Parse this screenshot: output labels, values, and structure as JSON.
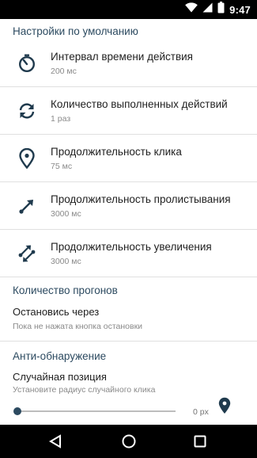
{
  "status_bar": {
    "time": "9:47"
  },
  "sections": {
    "defaults_header": "Настройки по умолчанию",
    "runs_header": "Количество прогонов",
    "anti_detect_header": "Анти-обнаружение"
  },
  "settings": [
    {
      "title": "Интервал времени действия",
      "value": "200 мс",
      "icon": "timer-icon"
    },
    {
      "title": "Количество выполненных действий",
      "value": "1 раз",
      "icon": "repeat-icon"
    },
    {
      "title": "Продолжительность клика",
      "value": "75 мс",
      "icon": "location-pin-icon"
    },
    {
      "title": "Продолжительность пролистывания",
      "value": "3000 мс",
      "icon": "swipe-arrow-icon"
    },
    {
      "title": "Продолжительность увеличения",
      "value": "3000 мс",
      "icon": "zoom-arrows-icon"
    }
  ],
  "runs": {
    "title": "Остановись через",
    "subtitle": "Пока не нажата кнопка остановки"
  },
  "anti_detect": {
    "title": "Случайная позиция",
    "subtitle": "Установите радиус случайного клика",
    "slider_value": "0 px",
    "slider_level": 0
  },
  "colors": {
    "accent": "#2c4a60",
    "divider": "#e0e0e0",
    "subtext": "#8a8a8a"
  }
}
